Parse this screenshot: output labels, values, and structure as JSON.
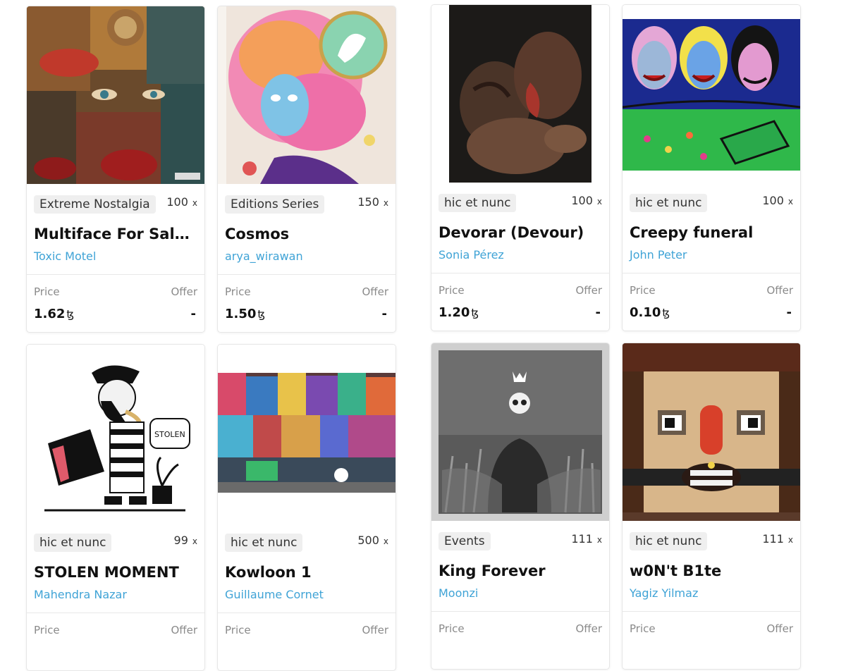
{
  "cards": [
    {
      "tag": "Extreme Nostalgia",
      "editions": "100",
      "mult": "x",
      "title": "Multiface For Sale ...",
      "artist": "Toxic Motel",
      "price_label": "Price",
      "offer_label": "Offer",
      "price": "1.62",
      "currency_symbol": "ꜩ",
      "offer": "-"
    },
    {
      "tag": "Editions Series",
      "editions": "150",
      "mult": "x",
      "title": "Cosmos",
      "artist": "arya_wirawan",
      "price_label": "Price",
      "offer_label": "Offer",
      "price": "1.50",
      "currency_symbol": "ꜩ",
      "offer": "-"
    },
    {
      "tag": "hic et nunc",
      "editions": "100",
      "mult": "x",
      "title": "Devorar (Devour)",
      "artist": "Sonia Pérez",
      "price_label": "Price",
      "offer_label": "Offer",
      "price": "1.20",
      "currency_symbol": "ꜩ",
      "offer": "-"
    },
    {
      "tag": "hic et nunc",
      "editions": "100",
      "mult": "x",
      "title": "Creepy funeral",
      "artist": "John Peter",
      "price_label": "Price",
      "offer_label": "Offer",
      "price": "0.10",
      "currency_symbol": "ꜩ",
      "offer": "-"
    },
    {
      "tag": "hic et nunc",
      "editions": "99",
      "mult": "x",
      "title": "STOLEN MOMENT",
      "artist": "Mahendra Nazar",
      "price_label": "Price",
      "offer_label": "Offer"
    },
    {
      "tag": "hic et nunc",
      "editions": "500",
      "mult": "x",
      "title": "Kowloon 1",
      "artist": "Guillaume Cornet",
      "price_label": "Price",
      "offer_label": "Offer"
    },
    {
      "tag": "Events",
      "editions": "111",
      "mult": "x",
      "title": "King Forever",
      "artist": "Moonzi",
      "price_label": "Price",
      "offer_label": "Offer"
    },
    {
      "tag": "hic et nunc",
      "editions": "111",
      "mult": "x",
      "title": "w0N't B1te",
      "artist": "Yagiz Yilmaz",
      "price_label": "Price",
      "offer_label": "Offer"
    }
  ],
  "colors": {
    "artist_link": "#3fa3d6",
    "tag_bg": "#efefef",
    "border": "#e6e6e6"
  },
  "artwork_stolen_speech": "STOLEN"
}
